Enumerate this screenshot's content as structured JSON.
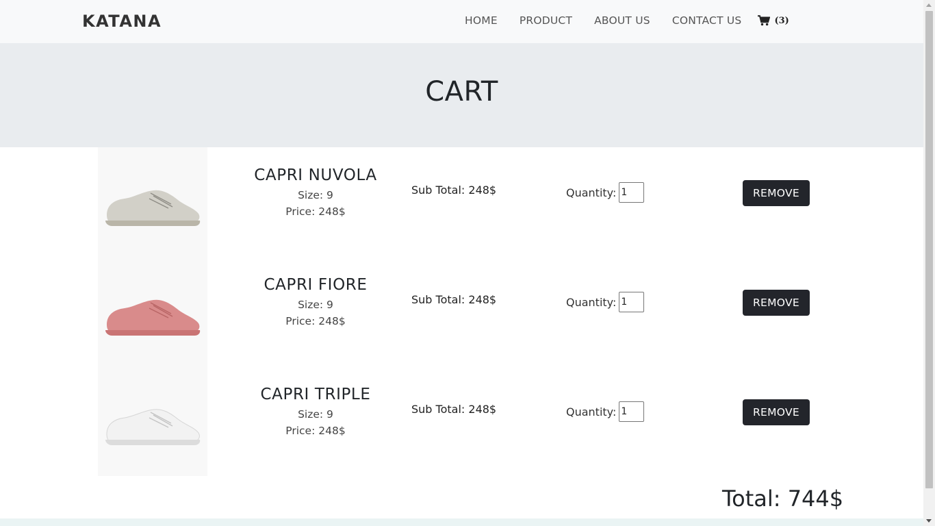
{
  "navbar": {
    "brand": "KATANA",
    "links": [
      {
        "label": "HOME"
      },
      {
        "label": "PRODUCT"
      },
      {
        "label": "ABOUT US"
      },
      {
        "label": "CONTACT US"
      }
    ],
    "cart_icon": "shopping-cart-icon",
    "cart_count": "(3)"
  },
  "hero": {
    "title": "CART"
  },
  "cart": {
    "items": [
      {
        "name": "CAPRI NUVOLA",
        "size": "Size: 9",
        "price": "Price: 248$",
        "subtotal": "Sub Total: 248$",
        "quantity_label": "Quantity:",
        "quantity": "1",
        "remove_label": "REMOVE",
        "shoe_color": "#d2d0c8",
        "sole_color": "#b9b5a8"
      },
      {
        "name": "CAPRI FIORE",
        "size": "Size: 9",
        "price": "Price: 248$",
        "subtotal": "Sub Total: 248$",
        "quantity_label": "Quantity:",
        "quantity": "1",
        "remove_label": "REMOVE",
        "shoe_color": "#d98b8b",
        "sole_color": "#c97474"
      },
      {
        "name": "CAPRI TRIPLE",
        "size": "Size: 9",
        "price": "Price: 248$",
        "subtotal": "Sub Total: 248$",
        "quantity_label": "Quantity:",
        "quantity": "1",
        "remove_label": "REMOVE",
        "shoe_color": "#f2f2f2",
        "sole_color": "#dcdcdc"
      }
    ],
    "total": "Total: 744$"
  },
  "colors": {
    "navbar_bg": "#f8f9fa",
    "hero_bg": "#e9ecef",
    "button_bg": "#23252b"
  }
}
